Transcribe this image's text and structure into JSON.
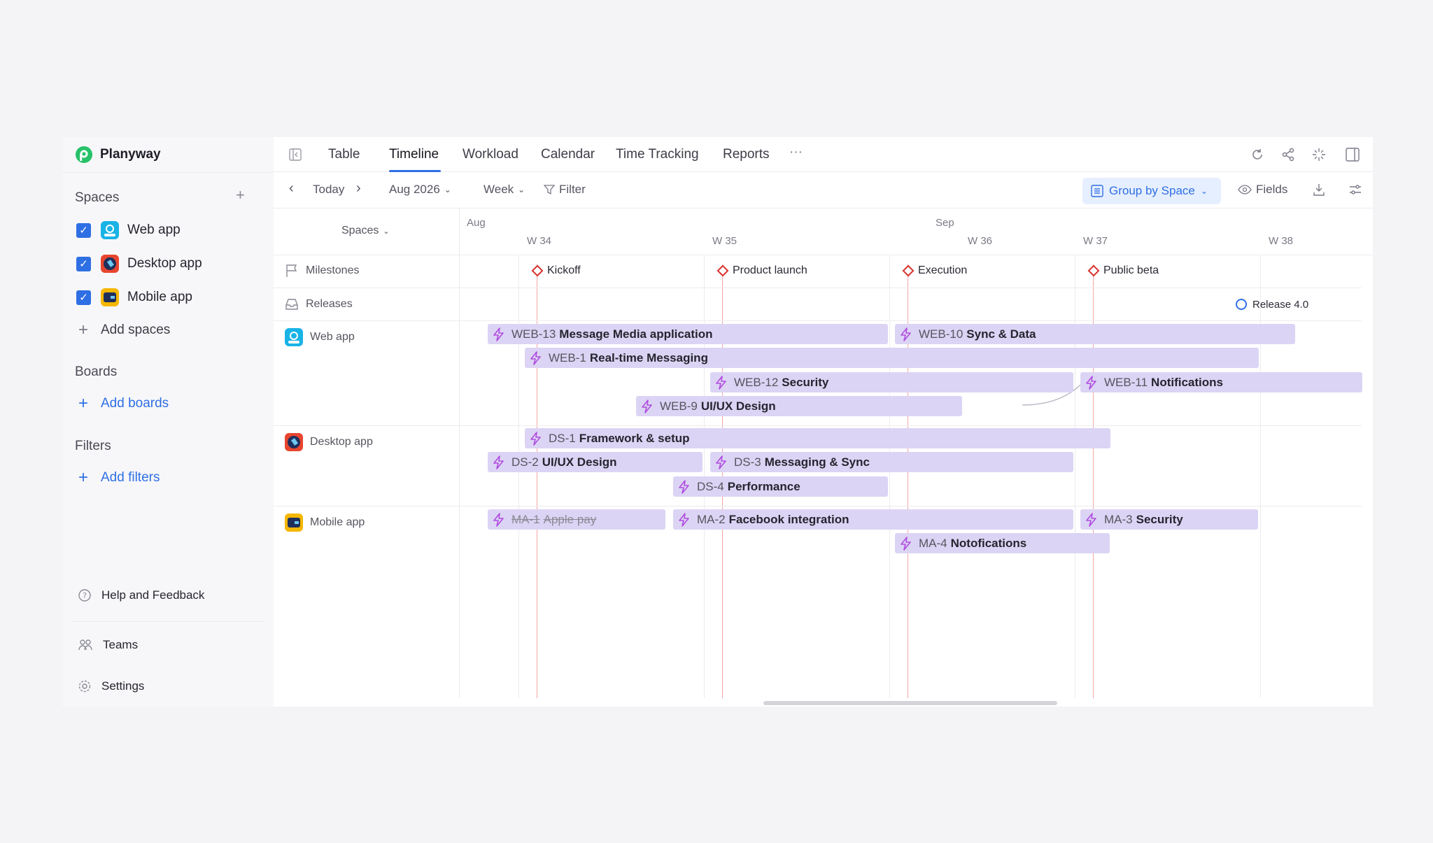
{
  "app": {
    "name": "Planyway"
  },
  "sidebar": {
    "spaces_heading": "Spaces",
    "spaces": [
      {
        "label": "Web app",
        "checked": true,
        "icon": "web-app-icon",
        "color": "#19b3e6"
      },
      {
        "label": "Desktop app",
        "checked": true,
        "icon": "desktop-app-icon",
        "color": "#e8452f"
      },
      {
        "label": "Mobile app",
        "checked": true,
        "icon": "mobile-app-icon",
        "color": "#f5b700"
      }
    ],
    "add_spaces": "Add spaces",
    "boards_heading": "Boards",
    "add_boards": "Add boards",
    "filters_heading": "Filters",
    "add_filters": "Add filters",
    "help": "Help and Feedback",
    "teams": "Teams",
    "settings": "Settings"
  },
  "tabs": [
    "Table",
    "Timeline",
    "Workload",
    "Calendar",
    "Time Tracking",
    "Reports"
  ],
  "active_tab": "Timeline",
  "more_tabs": "···",
  "toolbar": {
    "today": "Today",
    "period": "Aug 2026",
    "scale": "Week",
    "filter": "Filter",
    "group_by": "Group by Space",
    "fields": "Fields"
  },
  "timeline": {
    "spaces_selector": "Spaces",
    "months": [
      "Aug",
      "Sep"
    ],
    "weeks": [
      "W 34",
      "W 35",
      "W 36",
      "W 37",
      "W 38"
    ],
    "rows": {
      "milestones": "Milestones",
      "releases": "Releases",
      "web_app": "Web app",
      "desktop_app": "Desktop app",
      "mobile_app": "Mobile app"
    },
    "milestones": [
      "Kickoff",
      "Product launch",
      "Execution",
      "Public beta"
    ],
    "release": "Release 4.0",
    "tasks": {
      "web13": {
        "key": "WEB-13",
        "title": "Message Media application"
      },
      "web10": {
        "key": "WEB-10",
        "title": "Sync & Data"
      },
      "web1": {
        "key": "WEB-1",
        "title": "Real-time Messaging"
      },
      "web12": {
        "key": "WEB-12",
        "title": "Security"
      },
      "web11": {
        "key": "WEB-11",
        "title": "Notifications"
      },
      "web9": {
        "key": "WEB-9",
        "title": "UI/UX Design"
      },
      "ds1": {
        "key": "DS-1",
        "title": "Framework & setup"
      },
      "ds2": {
        "key": "DS-2",
        "title": "UI/UX Design"
      },
      "ds3": {
        "key": "DS-3",
        "title": "Messaging & Sync"
      },
      "ds4": {
        "key": "DS-4",
        "title": "Performance"
      },
      "ma1": {
        "key": "MA-1",
        "title": "Apple pay",
        "completed": true
      },
      "ma2": {
        "key": "MA-2",
        "title": "Facebook integration"
      },
      "ma3": {
        "key": "MA-3",
        "title": "Security"
      },
      "ma4": {
        "key": "MA-4",
        "title": "Notofications"
      }
    }
  },
  "colors": {
    "accent": "#2f6fe4",
    "task_bar": "#dcd4f4",
    "milestone": "#d9322f",
    "bolt": "#b04ce0"
  }
}
